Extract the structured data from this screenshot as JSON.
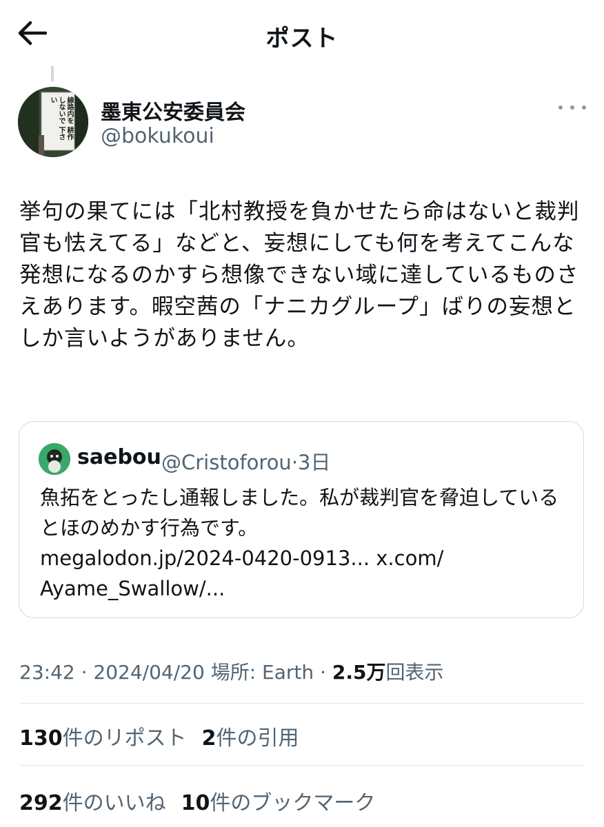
{
  "header": {
    "title": "ポスト"
  },
  "author": {
    "name": "墨東公安委員会",
    "handle": "@bokukoui",
    "avatar_sign_text": "線路内を 耕作しないで 下さい"
  },
  "post": {
    "text": "挙句の果てには「北村教授を負かせたら命はないと裁判官も怯えてる」などと、妄想にしても何を考えてこんな発想になるのかすら想像できない域に達しているものさえあります。暇空茜の「ナニカグループ」ばりの妄想としか言いようがありません。"
  },
  "quote": {
    "name": "saebou",
    "handle": "@Cristoforou",
    "separator": "·",
    "time": "3日",
    "text": "魚拓をとったし通報しました。私が裁判官を脅迫していると​ほのめかす行為です。\nmegalodon.jp/2024-0420-0913... x.com/\nAyame_Swallow/..."
  },
  "meta": {
    "time": "23:42",
    "sep1": " · ",
    "date": "2024/04/20",
    "location_label": " 場所: ",
    "location": "Earth",
    "sep2": " · ",
    "views_count": "2.5万",
    "views_label": "回表示"
  },
  "stats": {
    "reposts_count": "130",
    "reposts_label": "件のリポスト",
    "quotes_count": "2",
    "quotes_label": "件の引用",
    "likes_count": "292",
    "likes_label": "件のいいね",
    "bookmarks_count": "10",
    "bookmarks_label": "件のブックマーク"
  },
  "icons": {
    "back": "arrow-left-icon",
    "more": "more-horizontal-icon"
  },
  "colors": {
    "text_primary": "#0f1419",
    "text_secondary": "#536471",
    "border": "#cfd9de",
    "background": "#ffffff"
  }
}
